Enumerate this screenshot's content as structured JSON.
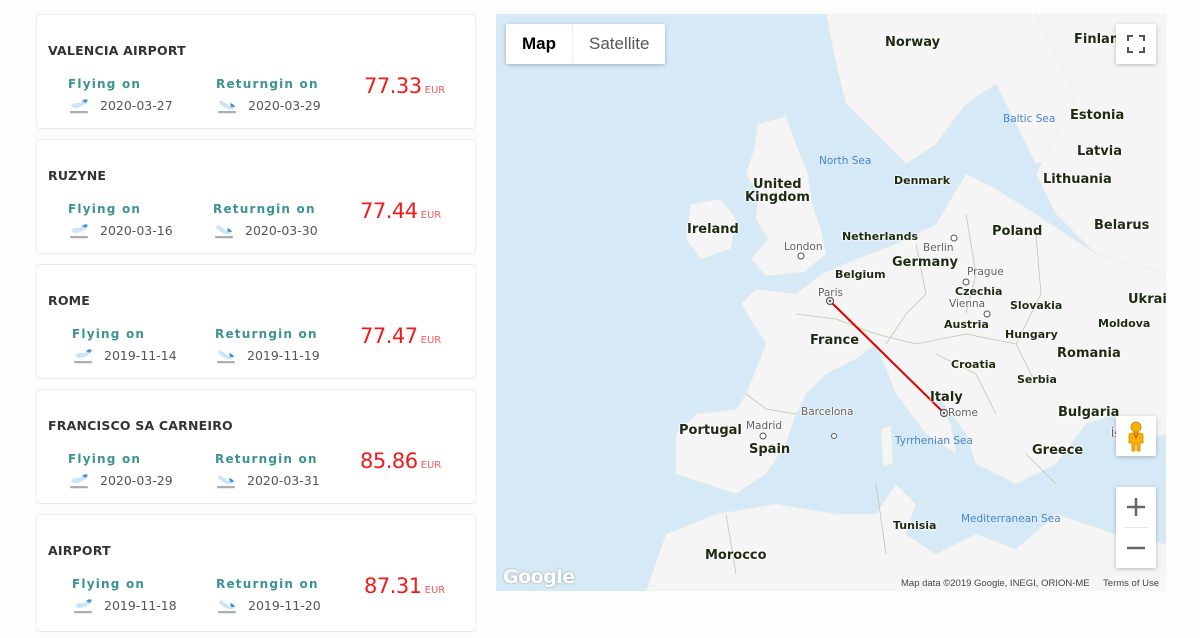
{
  "flights": [
    {
      "destination": "VALENCIA AIRPORT",
      "flying_label": "Flying on",
      "flying_date": "2020-03-27",
      "returning_label": "Returngin on",
      "returning_date": "2020-03-29",
      "price": "77.33",
      "currency": "EUR"
    },
    {
      "destination": "RUZYNE",
      "flying_label": "Flying on",
      "flying_date": "2020-03-16",
      "returning_label": "Returngin on",
      "returning_date": "2020-03-30",
      "price": "77.44",
      "currency": "EUR"
    },
    {
      "destination": "ROME",
      "flying_label": "Flying on",
      "flying_date": "2019-11-14",
      "returning_label": "Returngin on",
      "returning_date": "2019-11-19",
      "price": "77.47",
      "currency": "EUR"
    },
    {
      "destination": "FRANCISCO SA CARNEIRO",
      "flying_label": "Flying on",
      "flying_date": "2020-03-29",
      "returning_label": "Returngin on",
      "returning_date": "2020-03-31",
      "price": "85.86",
      "currency": "EUR"
    },
    {
      "destination": "AIRPORT",
      "flying_label": "Flying on",
      "flying_date": "2019-11-18",
      "returning_label": "Returngin on",
      "returning_date": "2019-11-20",
      "price": "87.31",
      "currency": "EUR"
    }
  ],
  "map": {
    "type_buttons": {
      "map": "Map",
      "satellite": "Satellite"
    },
    "active_type": "Map",
    "route": {
      "from": "Paris",
      "to": "Rome",
      "color": "#e00000"
    },
    "countries": [
      "Norway",
      "Finland",
      "Estonia",
      "Latvia",
      "Lithuania",
      "United Kingdom",
      "Ireland",
      "Denmark",
      "Netherlands",
      "Belgium",
      "Germany",
      "Poland",
      "Belarus",
      "Czechia",
      "Slovakia",
      "Austria",
      "Hungary",
      "Ukraine",
      "Moldova",
      "France",
      "Romania",
      "Croatia",
      "Serbia",
      "Italy",
      "Bulgaria",
      "Portugal",
      "Spain",
      "Greece",
      "Tunisia",
      "Morocco"
    ],
    "cities": [
      "London",
      "Berlin",
      "Prague",
      "Vienna",
      "Paris",
      "Rome",
      "Madrid",
      "Barcelona",
      "İstanbul"
    ],
    "seas": [
      "North Sea",
      "Baltic Sea",
      "Tyrrhenian Sea",
      "Mediterranean Sea"
    ],
    "labels": {
      "norway": "Norway",
      "finland": "Finlan",
      "estonia": "Estonia",
      "latvia": "Latvia",
      "lithuania": "Lithuania",
      "uk1": "United",
      "uk2": "Kingdom",
      "ireland": "Ireland",
      "denmark": "Denmark",
      "netherlands": "Netherlands",
      "belgium": "Belgium",
      "germany": "Germany",
      "poland": "Poland",
      "belarus": "Belarus",
      "czechia": "Czechia",
      "slovakia": "Slovakia",
      "austria": "Austria",
      "hungary": "Hungary",
      "ukraine": "Ukrai",
      "moldova": "Moldova",
      "france": "France",
      "romania": "Romania",
      "croatia": "Croatia",
      "serbia": "Serbia",
      "italy": "Italy",
      "bulgaria": "Bulgaria",
      "portugal": "Portugal",
      "spain": "Spain",
      "greece": "Greece",
      "tunisia": "Tunisia",
      "morocco": "Morocco",
      "london": "London",
      "berlin": "Berlin",
      "prague": "Prague",
      "vienna": "Vienna",
      "paris": "Paris",
      "rome": "Rome",
      "madrid": "Madrid",
      "barcelona": "Barcelona",
      "istanbul": "İs",
      "north_sea": "North Sea",
      "baltic_sea": "Baltic Sea",
      "tyrrhenian_sea": "Tyrrhenian Sea",
      "med_sea": "Mediterranean Sea"
    },
    "logo": "Google",
    "attribution": "Map data ©2019 Google, INEGI, ORION-ME",
    "terms": "Terms of Use",
    "zoom_in": "+",
    "zoom_out": "−"
  },
  "icons": {
    "plane_depart": "plane-takeoff-icon",
    "plane_return": "plane-landing-icon",
    "fullscreen": "fullscreen-icon",
    "pegman": "street-view-pegman-icon"
  },
  "colors": {
    "label_teal": "#3d9393",
    "price_red": "#f21a1a",
    "water": "#d6e9f6",
    "land": "#f5f5f5"
  }
}
